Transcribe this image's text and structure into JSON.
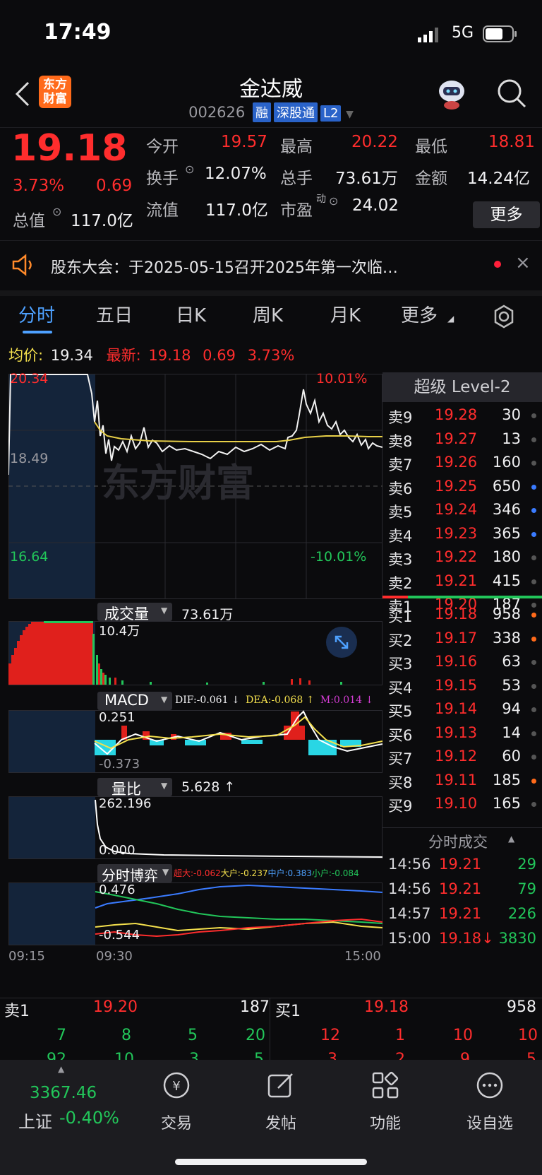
{
  "status_bar": {
    "time": "17:49",
    "network": "5G"
  },
  "header": {
    "title": "金达威",
    "code": "002626",
    "tags": [
      "融",
      "深股通",
      "L2"
    ],
    "logo_text": "东方财富"
  },
  "quote": {
    "price": "19.18",
    "change_pct": "3.73%",
    "change": "0.69",
    "open_label": "今开",
    "open": "19.57",
    "high_label": "最高",
    "high": "20.22",
    "low_label": "最低",
    "low": "18.81",
    "turnover_label": "换手",
    "turnover": "12.07%",
    "volume_label": "总手",
    "volume": "73.61万",
    "amount_label": "金额",
    "amount": "14.24亿",
    "mktcap_label": "总值",
    "mktcap": "117.0亿",
    "float_label": "流值",
    "float_cap": "117.0亿",
    "pe_label": "市盈",
    "pe_sup": "动",
    "pe": "24.02",
    "more_button": "更多"
  },
  "notice": {
    "text": "股东大会：于2025-05-15召开2025年第一次临…"
  },
  "tabs": {
    "items": [
      "分时",
      "五日",
      "日K",
      "周K",
      "月K",
      "更多"
    ],
    "active": "分时"
  },
  "info_line": {
    "avg_label": "均价:",
    "avg": "19.34",
    "latest_label": "最新:",
    "latest": "19.18",
    "change": "0.69",
    "pct": "3.73%"
  },
  "price_chart": {
    "top_price": "20.34",
    "mid_price": "18.49",
    "bottom_price": "16.64",
    "top_pct": "10.01%",
    "bottom_pct": "-10.01%",
    "watermark": "东方财富"
  },
  "volume_panel": {
    "selector": "成交量",
    "value": "73.61万",
    "max": "10.4万"
  },
  "macd_panel": {
    "selector": "MACD",
    "dif": "DIF:-0.061 ↓",
    "dea": "DEA:-0.068 ↑",
    "m": "M:0.014 ↓",
    "top": "0.251",
    "bottom": "-0.373"
  },
  "ratio_panel": {
    "selector": "量比",
    "value": "5.628 ↑",
    "top": "262.196",
    "bottom": "0.000"
  },
  "game_panel": {
    "selector": "分时博弈",
    "super": "超大:-0.062",
    "big": "大户:-0.237",
    "mid": "中户:0.383",
    "small": "小户:-0.084",
    "top": "0.476",
    "bottom": "-0.544"
  },
  "time_axis": {
    "t1": "09:15",
    "t2": "09:30",
    "t3": "15:00"
  },
  "order_book": {
    "title": "超级 Level-2",
    "sells": [
      {
        "label": "卖9",
        "price": "19.28",
        "vol": "30"
      },
      {
        "label": "卖8",
        "price": "19.27",
        "vol": "13"
      },
      {
        "label": "卖7",
        "price": "19.26",
        "vol": "160"
      },
      {
        "label": "卖6",
        "price": "19.25",
        "vol": "650"
      },
      {
        "label": "卖5",
        "price": "19.24",
        "vol": "346"
      },
      {
        "label": "卖4",
        "price": "19.23",
        "vol": "365"
      },
      {
        "label": "卖3",
        "price": "19.22",
        "vol": "180"
      },
      {
        "label": "卖2",
        "price": "19.21",
        "vol": "415"
      },
      {
        "label": "卖1",
        "price": "19.20",
        "vol": "187"
      }
    ],
    "buys": [
      {
        "label": "买1",
        "price": "19.18",
        "vol": "958"
      },
      {
        "label": "买2",
        "price": "19.17",
        "vol": "338"
      },
      {
        "label": "买3",
        "price": "19.16",
        "vol": "63"
      },
      {
        "label": "买4",
        "price": "19.15",
        "vol": "53"
      },
      {
        "label": "买5",
        "price": "19.14",
        "vol": "94"
      },
      {
        "label": "买6",
        "price": "19.13",
        "vol": "14"
      },
      {
        "label": "买7",
        "price": "19.12",
        "vol": "60"
      },
      {
        "label": "买8",
        "price": "19.11",
        "vol": "185"
      },
      {
        "label": "买9",
        "price": "19.10",
        "vol": "165"
      }
    ],
    "ticks_title": "分时成交",
    "ticks": [
      {
        "time": "14:56",
        "price": "19.21",
        "vol": "29"
      },
      {
        "time": "14:56",
        "price": "19.21",
        "vol": "79"
      },
      {
        "time": "14:57",
        "price": "19.21",
        "vol": "226"
      },
      {
        "time": "15:00",
        "price": "19.18↓",
        "vol": "3830"
      }
    ]
  },
  "trade_bar": {
    "sell_label": "卖1",
    "sell_price": "19.20",
    "sell_vol": "187",
    "buy_label": "买1",
    "buy_price": "19.18",
    "buy_vol": "958",
    "sell_queue": [
      "7",
      "8",
      "5",
      "20"
    ],
    "sell_queue2": [
      "92",
      "10",
      "3",
      "5"
    ],
    "buy_queue": [
      "12",
      "1",
      "10",
      "10"
    ],
    "buy_queue2": [
      "3",
      "2",
      "9",
      "5"
    ]
  },
  "bottom_nav": {
    "index_value": "3367.46",
    "index_name": "上证",
    "index_change": "-0.40%",
    "items": [
      "交易",
      "发帖",
      "功能",
      "设自选"
    ]
  }
}
